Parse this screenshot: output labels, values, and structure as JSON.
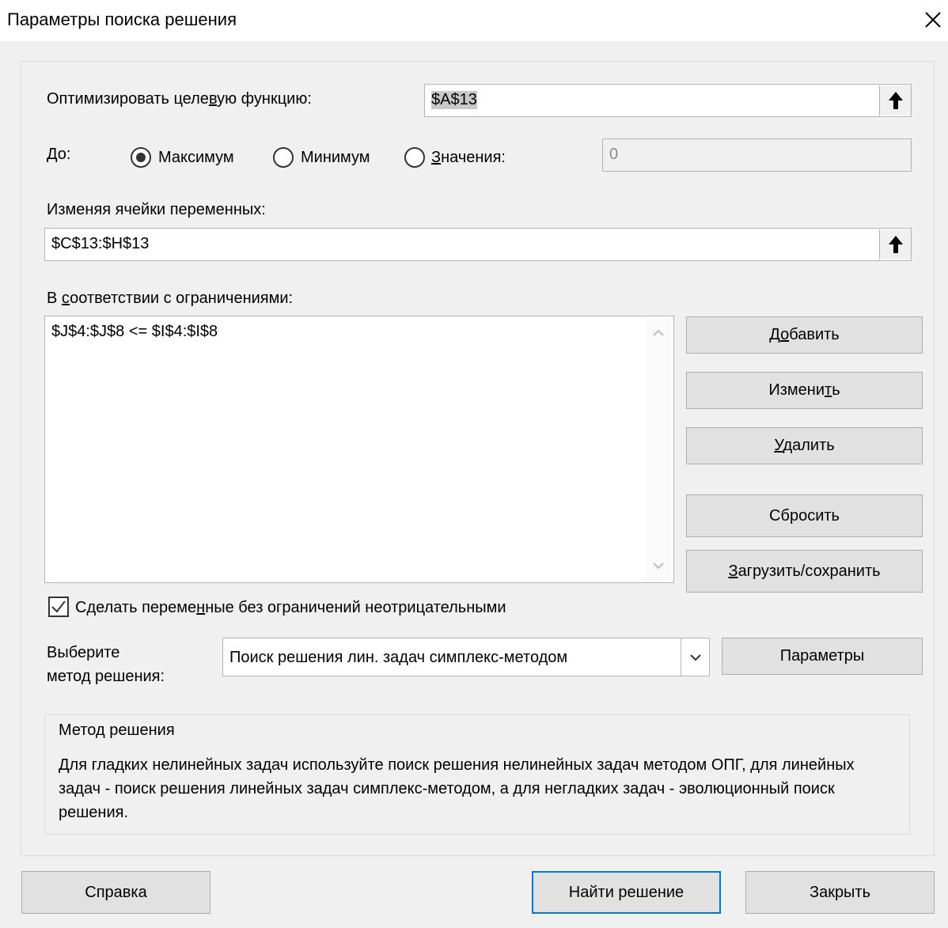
{
  "window": {
    "title": "Параметры поиска решения",
    "close_label": "Закрыть окно"
  },
  "objective": {
    "label": "Оптимизировать целевую функцию:",
    "value": "$A$13"
  },
  "to": {
    "label": "До:",
    "options": [
      {
        "label": "Максимум",
        "selected": true
      },
      {
        "label": "Минимум",
        "selected": false
      },
      {
        "label": "Значения:",
        "selected": false
      }
    ],
    "value_field": "0"
  },
  "variables": {
    "label": "Изменяя ячейки переменных:",
    "value": "$C$13:$H$13"
  },
  "constraints": {
    "label": "В соответствии с ограничениями:",
    "items": [
      "$J$4:$J$8 <= $I$4:$I$8"
    ]
  },
  "buttons": {
    "add": "Добавить",
    "change": "Изменить",
    "delete": "Удалить",
    "reset": "Сбросить",
    "load_save": "Загрузить/сохранить",
    "options": "Параметры",
    "help": "Справка",
    "solve": "Найти решение",
    "close": "Закрыть"
  },
  "nonneg": {
    "label": "Сделать переменные без ограничений неотрицательными",
    "checked": true
  },
  "method": {
    "label_line1": "Выберите",
    "label_line2": "метод решения:",
    "selected": "Поиск решения лин. задач симплекс-методом"
  },
  "method_info": {
    "title": "Метод решения",
    "text": "Для гладких нелинейных задач используйте поиск решения нелинейных задач методом ОПГ, для линейных задач - поиск решения линейных задач симплекс-методом, а для негладких задач - эволюционный поиск решения."
  },
  "colors": {
    "accent": "#0078d7",
    "background": "#f0f0f0",
    "button": "#e1e1e1"
  }
}
